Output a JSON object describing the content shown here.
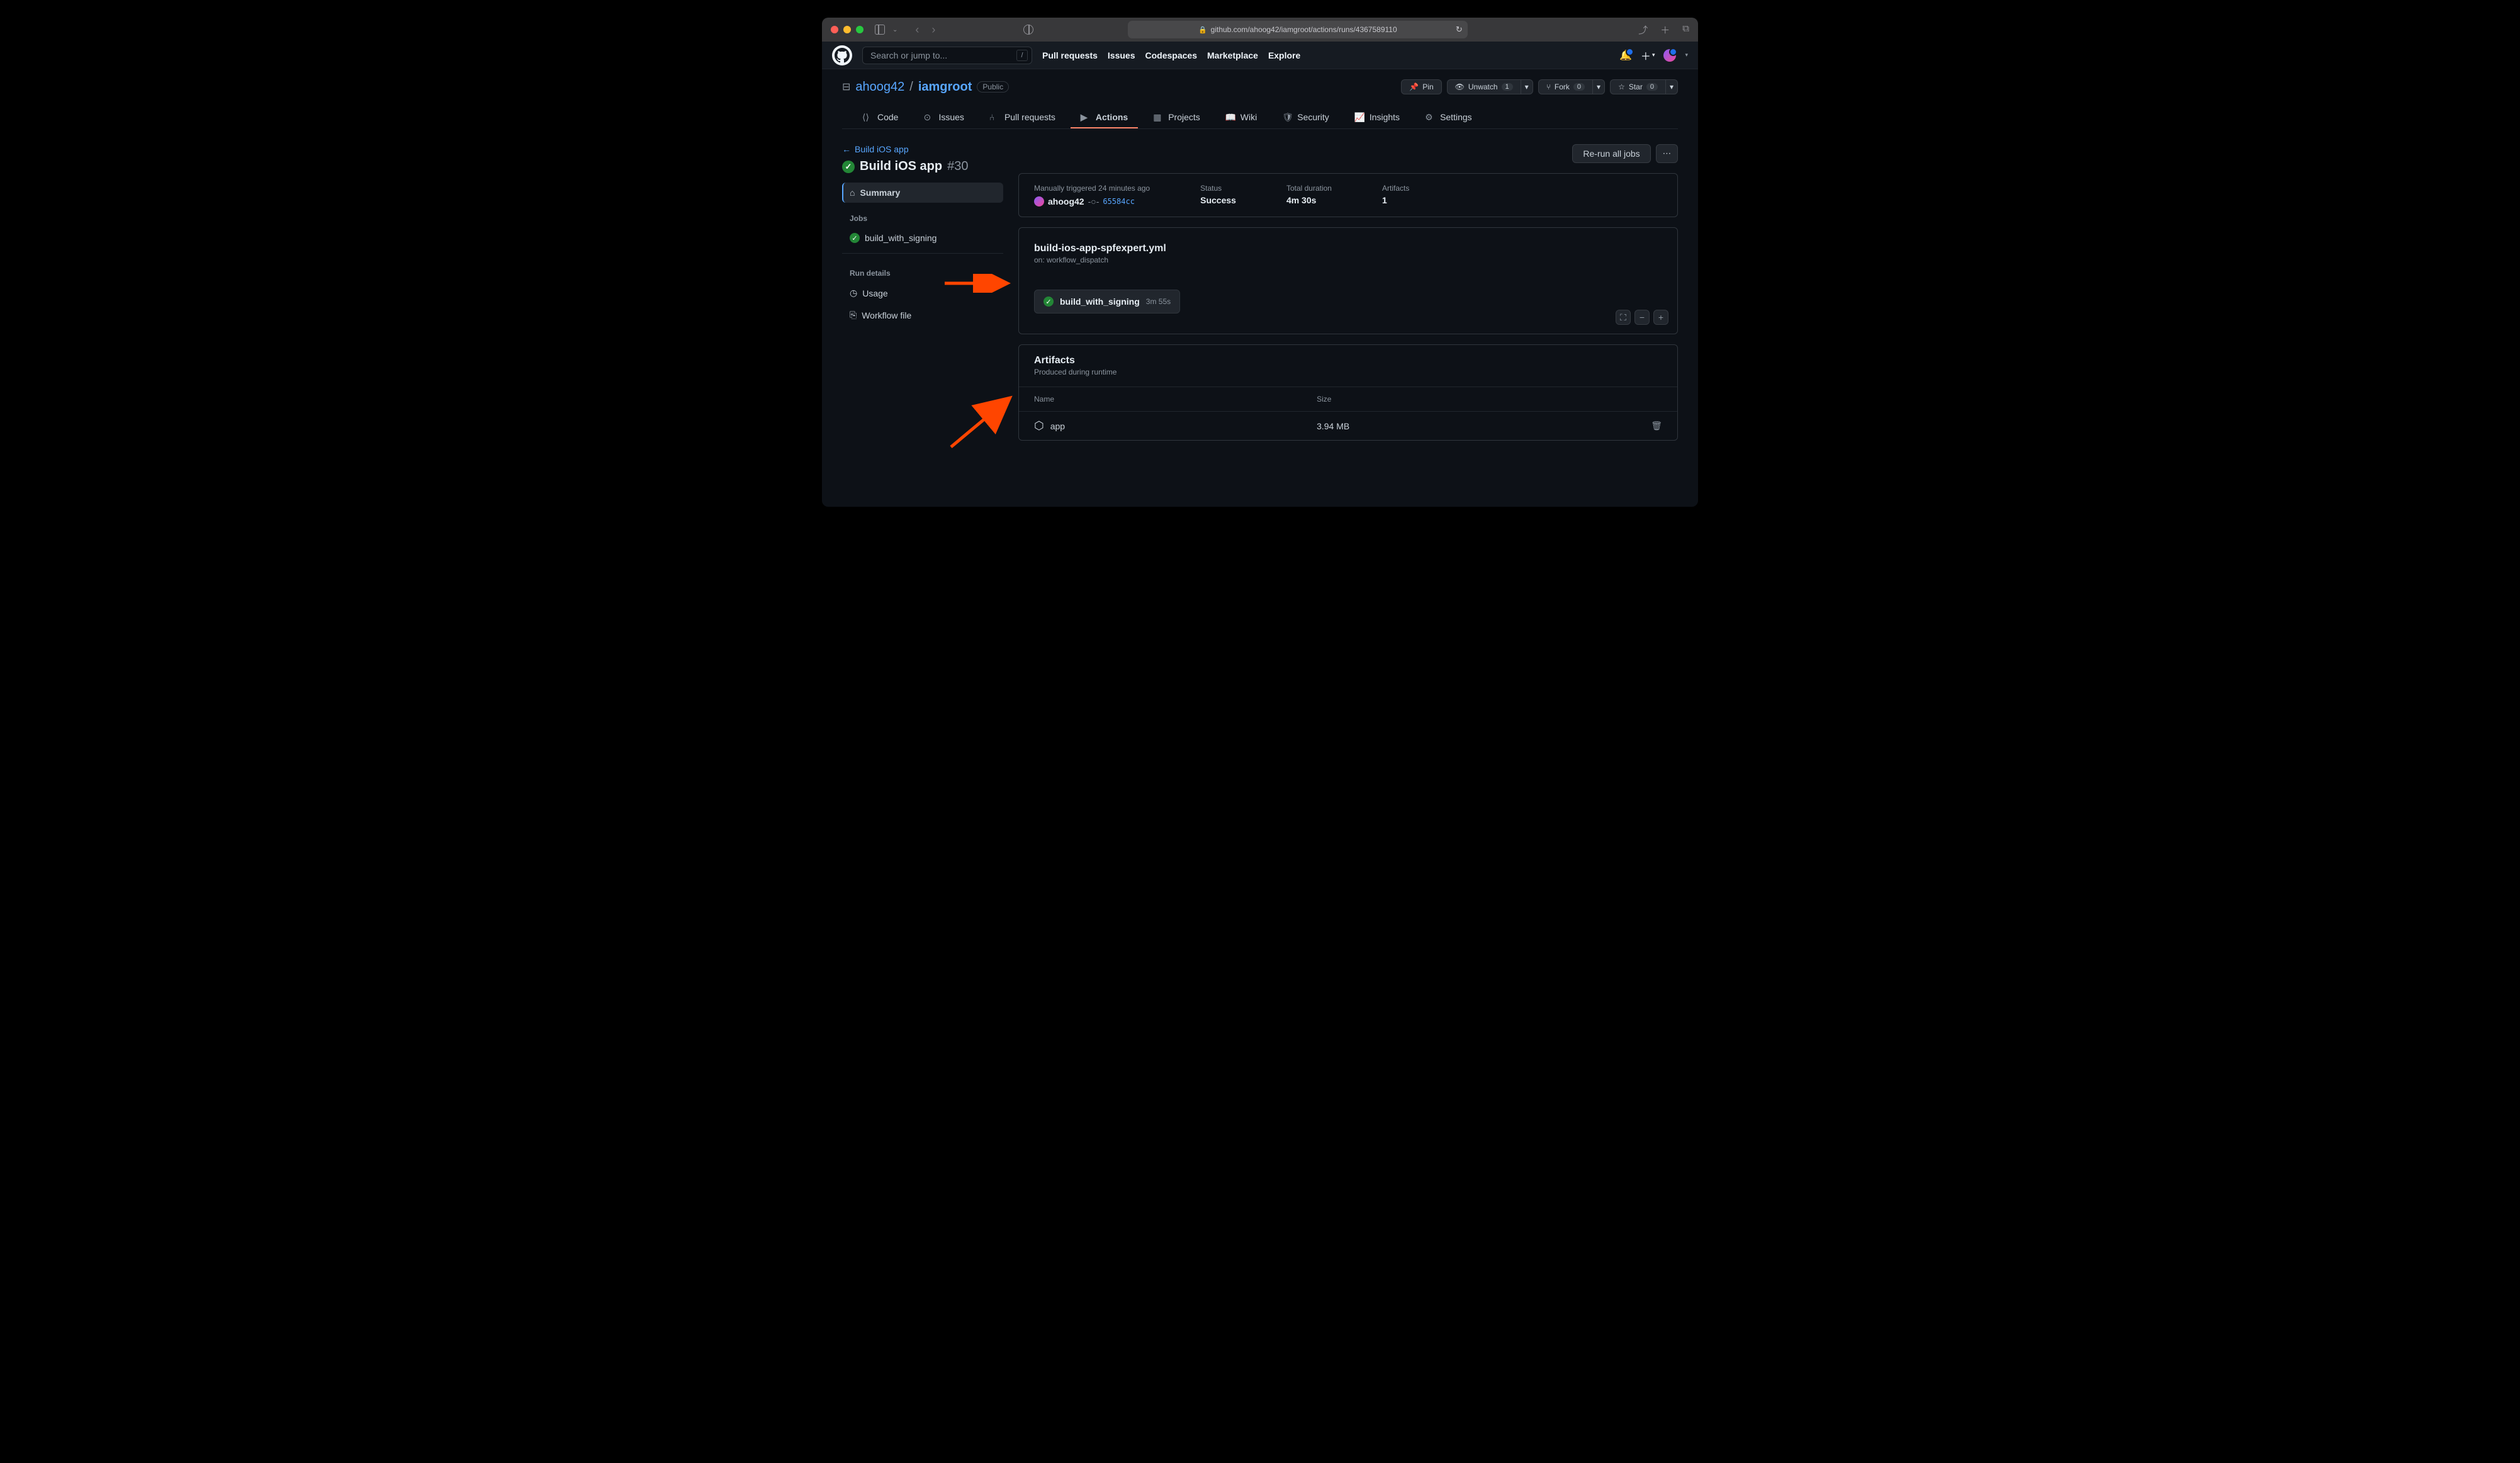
{
  "browser": {
    "url": "github.com/ahoog42/iamgroot/actions/runs/4367589110"
  },
  "gh": {
    "search_placeholder": "Search or jump to...",
    "nav": [
      "Pull requests",
      "Issues",
      "Codespaces",
      "Marketplace",
      "Explore"
    ]
  },
  "repo": {
    "owner": "ahoog42",
    "name": "iamgroot",
    "visibility": "Public",
    "actions": {
      "pin": "Pin",
      "unwatch": "Unwatch",
      "unwatch_count": "1",
      "fork": "Fork",
      "fork_count": "0",
      "star": "Star",
      "star_count": "0"
    },
    "tabs": [
      "Code",
      "Issues",
      "Pull requests",
      "Actions",
      "Projects",
      "Wiki",
      "Security",
      "Insights",
      "Settings"
    ]
  },
  "run": {
    "back": "Build iOS app",
    "title": "Build iOS app",
    "number": "#30",
    "rerun": "Re-run all jobs",
    "side": {
      "summary": "Summary",
      "jobs_hdr": "Jobs",
      "job1": "build_with_signing",
      "details_hdr": "Run details",
      "usage": "Usage",
      "workflow_file": "Workflow file"
    },
    "trigger_text": "Manually triggered 24 minutes ago",
    "trigger_user": "ahoog42",
    "commit": "65584cc",
    "status_lbl": "Status",
    "status": "Success",
    "duration_lbl": "Total duration",
    "duration": "4m 30s",
    "artifacts_lbl": "Artifacts",
    "artifacts_count": "1",
    "wf_file": "build-ios-app-spfexpert.yml",
    "wf_on": "on: workflow_dispatch",
    "job_name": "build_with_signing",
    "job_time": "3m 55s",
    "art_title": "Artifacts",
    "art_sub": "Produced during runtime",
    "art_cols": {
      "name": "Name",
      "size": "Size"
    },
    "art_rows": [
      {
        "name": "app",
        "size": "3.94 MB"
      }
    ]
  }
}
